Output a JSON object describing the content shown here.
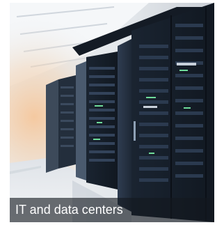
{
  "tile": {
    "caption": "IT and data centers",
    "image_subject": "server-racks-photo",
    "colors": {
      "rack": "#1b2533",
      "rack_light": "#2c3a4d",
      "floor": "#e9edf1",
      "ceiling": "#f4f6f8",
      "warm_light": "#f2c49a",
      "led_green": "#6fdc9a",
      "caption_overlay": "#14181e",
      "caption_text": "#ffffff"
    }
  }
}
